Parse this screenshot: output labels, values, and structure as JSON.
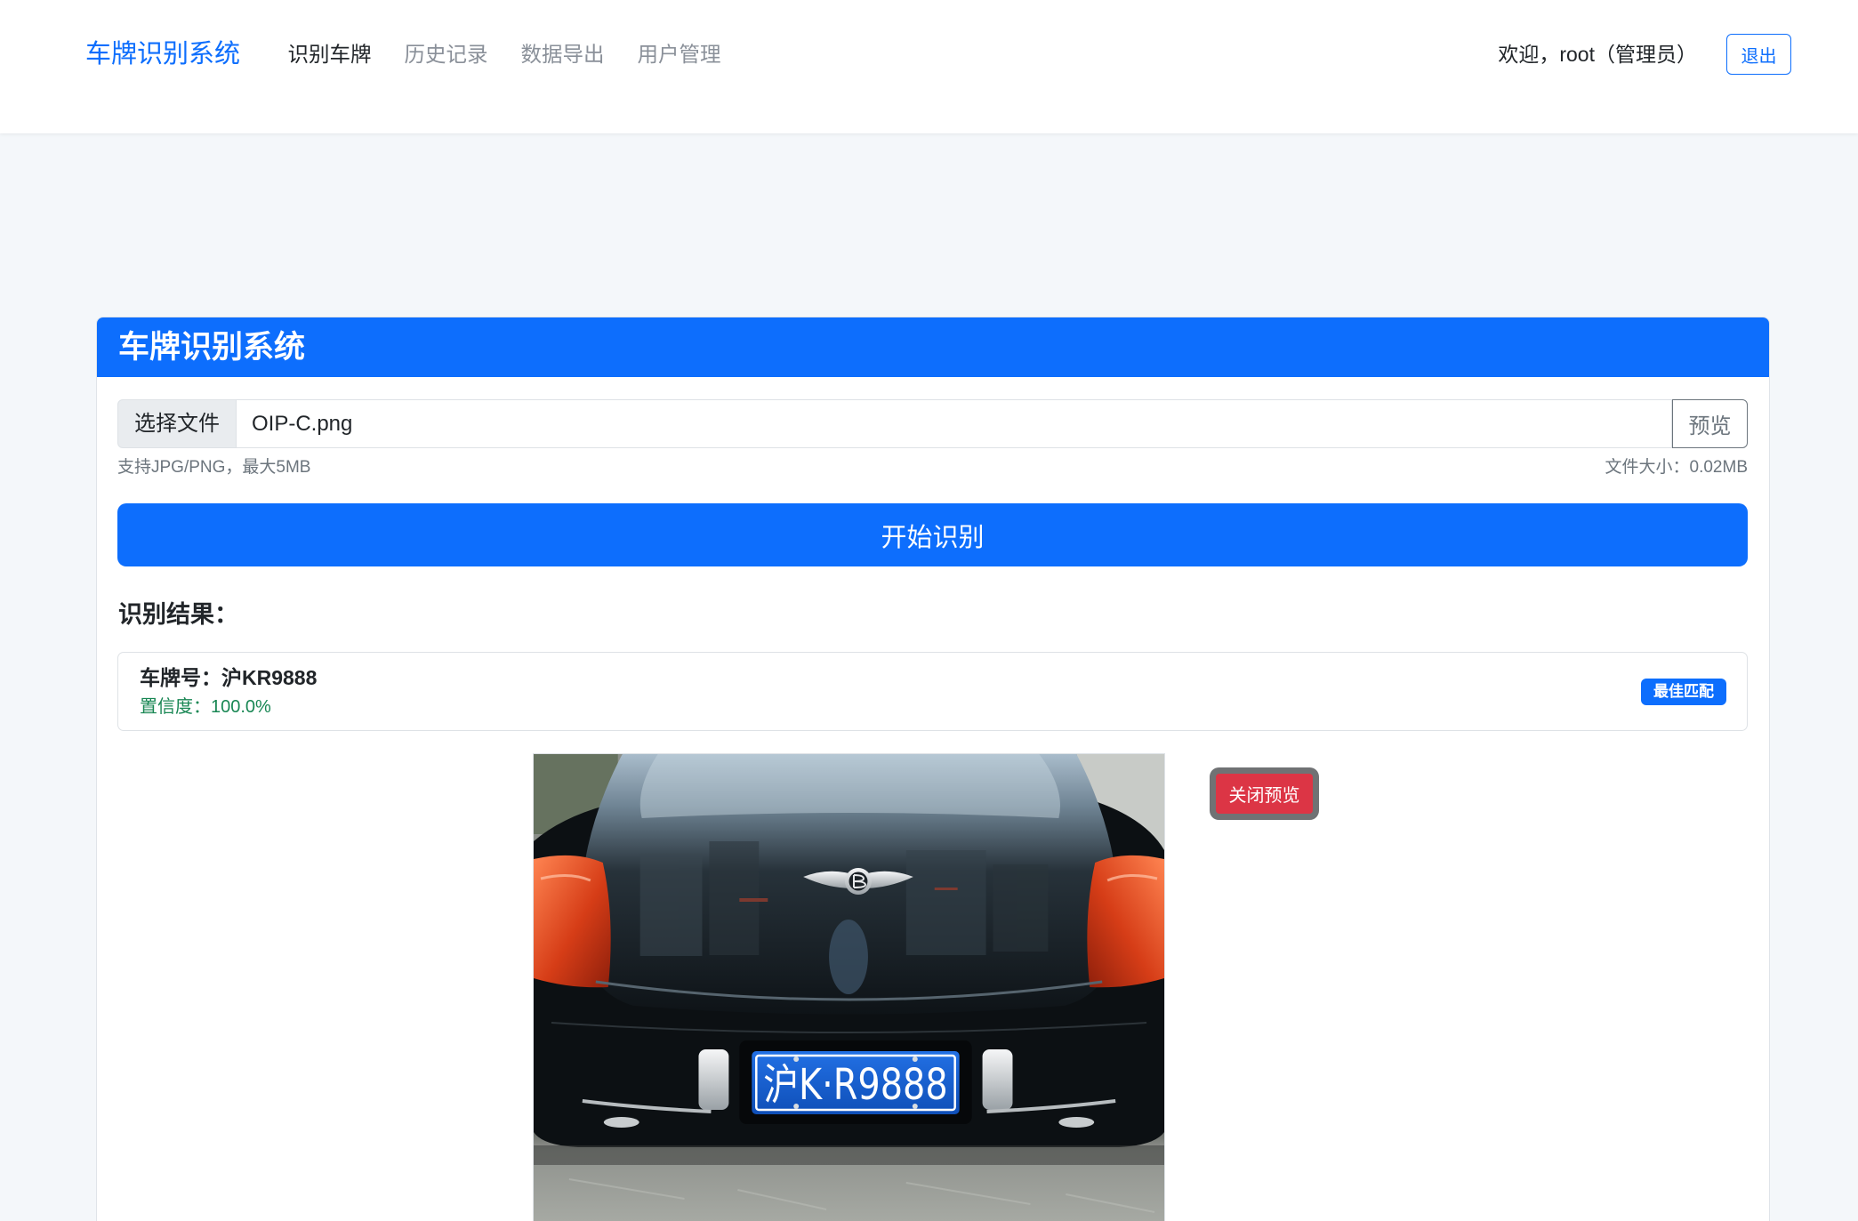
{
  "theme": {
    "primary": "#0d6efd",
    "danger": "#dc3545",
    "success": "#198754",
    "muted": "#6c757d"
  },
  "navbar": {
    "brand": "车牌识别系统",
    "links": [
      {
        "label": "识别车牌",
        "active": true
      },
      {
        "label": "历史记录",
        "active": false
      },
      {
        "label": "数据导出",
        "active": false
      },
      {
        "label": "用户管理",
        "active": false
      }
    ],
    "welcome": "欢迎，root（管理员）",
    "logout_label": "退出"
  },
  "card": {
    "title": "车牌识别系统",
    "file_input": {
      "choose_label": "选择文件",
      "file_name": "OIP-C.png",
      "preview_label": "预览"
    },
    "hint": "支持JPG/PNG，最大5MB",
    "file_size_label": "文件大小：",
    "file_size": "0.02MB",
    "start_label": "开始识别",
    "results_heading": "识别结果：",
    "results": [
      {
        "plate_label": "车牌号：",
        "plate": "沪KR9888",
        "confidence_label": "置信度：",
        "confidence": "100.0%",
        "badge": "最佳匹配"
      }
    ],
    "preview": {
      "plate_in_photo": "沪K·R9888",
      "close_label": "关闭预览"
    }
  }
}
